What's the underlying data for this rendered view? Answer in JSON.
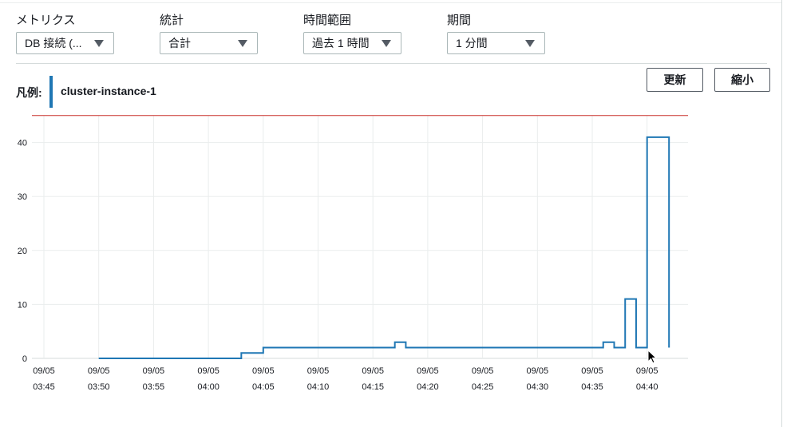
{
  "controls": {
    "metric": {
      "label": "メトリクス",
      "value": "DB 接続 (..."
    },
    "statistic": {
      "label": "統計",
      "value": "合計"
    },
    "time_range": {
      "label": "時間範囲",
      "value": "過去 1 時間"
    },
    "period": {
      "label": "期間",
      "value": "1 分間"
    }
  },
  "buttons": {
    "refresh": "更新",
    "zoom_out": "縮小"
  },
  "legend": {
    "label": "凡例:",
    "series_name": "cluster-instance-1",
    "color": "#1f77b4"
  },
  "chart_data": {
    "type": "line",
    "step": true,
    "ylim": [
      0,
      45
    ],
    "yticks": [
      0,
      10,
      20,
      30,
      40
    ],
    "xticks": [
      [
        "09/05",
        "03:45"
      ],
      [
        "09/05",
        "03:50"
      ],
      [
        "09/05",
        "03:55"
      ],
      [
        "09/05",
        "04:00"
      ],
      [
        "09/05",
        "04:05"
      ],
      [
        "09/05",
        "04:10"
      ],
      [
        "09/05",
        "04:15"
      ],
      [
        "09/05",
        "04:20"
      ],
      [
        "09/05",
        "04:25"
      ],
      [
        "09/05",
        "04:30"
      ],
      [
        "09/05",
        "04:35"
      ],
      [
        "09/05",
        "04:40"
      ]
    ],
    "threshold": {
      "value": 45,
      "color": "#c9302c"
    },
    "grid": true,
    "series": [
      {
        "color": "#1f77b4",
        "points": [
          [
            "03:50",
            0
          ],
          [
            "04:03",
            1
          ],
          [
            "04:05",
            2
          ],
          [
            "04:17",
            3
          ],
          [
            "04:18",
            2
          ],
          [
            "04:36",
            3
          ],
          [
            "04:37",
            2
          ],
          [
            "04:38",
            11
          ],
          [
            "04:39",
            2
          ],
          [
            "04:40",
            41
          ],
          [
            "04:42",
            2
          ]
        ]
      }
    ]
  }
}
